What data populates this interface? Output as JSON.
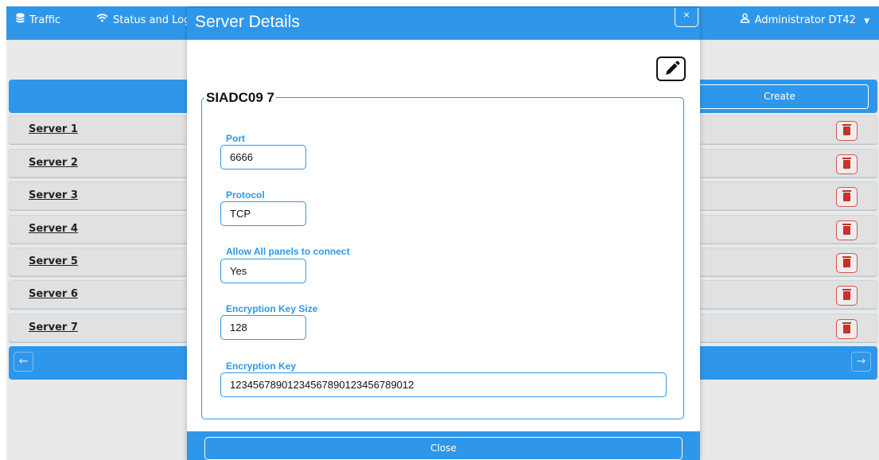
{
  "nav": {
    "items": [
      {
        "label": "Traffic",
        "icon": "database-icon"
      },
      {
        "label": "Status and Log",
        "icon": "wifi-icon"
      }
    ],
    "user": {
      "label": "Administrator DT42",
      "icon": "user-icon"
    }
  },
  "list": {
    "create_label": "Create",
    "servers": [
      {
        "name": "Server 1"
      },
      {
        "name": "Server 2"
      },
      {
        "name": "Server 3"
      },
      {
        "name": "Server 4"
      },
      {
        "name": "Server 5"
      },
      {
        "name": "Server 6"
      },
      {
        "name": "Server 7"
      }
    ],
    "prev_icon": "arrow-left-icon",
    "next_icon": "arrow-right-icon"
  },
  "modal": {
    "title": "Server Details",
    "close_x": "×",
    "legend": "SIADC09 7",
    "edit_icon": "pencil-icon",
    "fields": [
      {
        "label": "Port",
        "value": "6666"
      },
      {
        "label": "Protocol",
        "value": "TCP"
      },
      {
        "label": "Allow All panels to connect",
        "value": "Yes"
      },
      {
        "label": "Encryption Key Size",
        "value": "128"
      },
      {
        "label": "Encryption Key",
        "value": "12345678901234567890123456789012"
      }
    ],
    "close_label": "Close"
  },
  "colors": {
    "accent": "#2f97ea",
    "danger": "#d9534f",
    "background": "#e9e9e9"
  }
}
